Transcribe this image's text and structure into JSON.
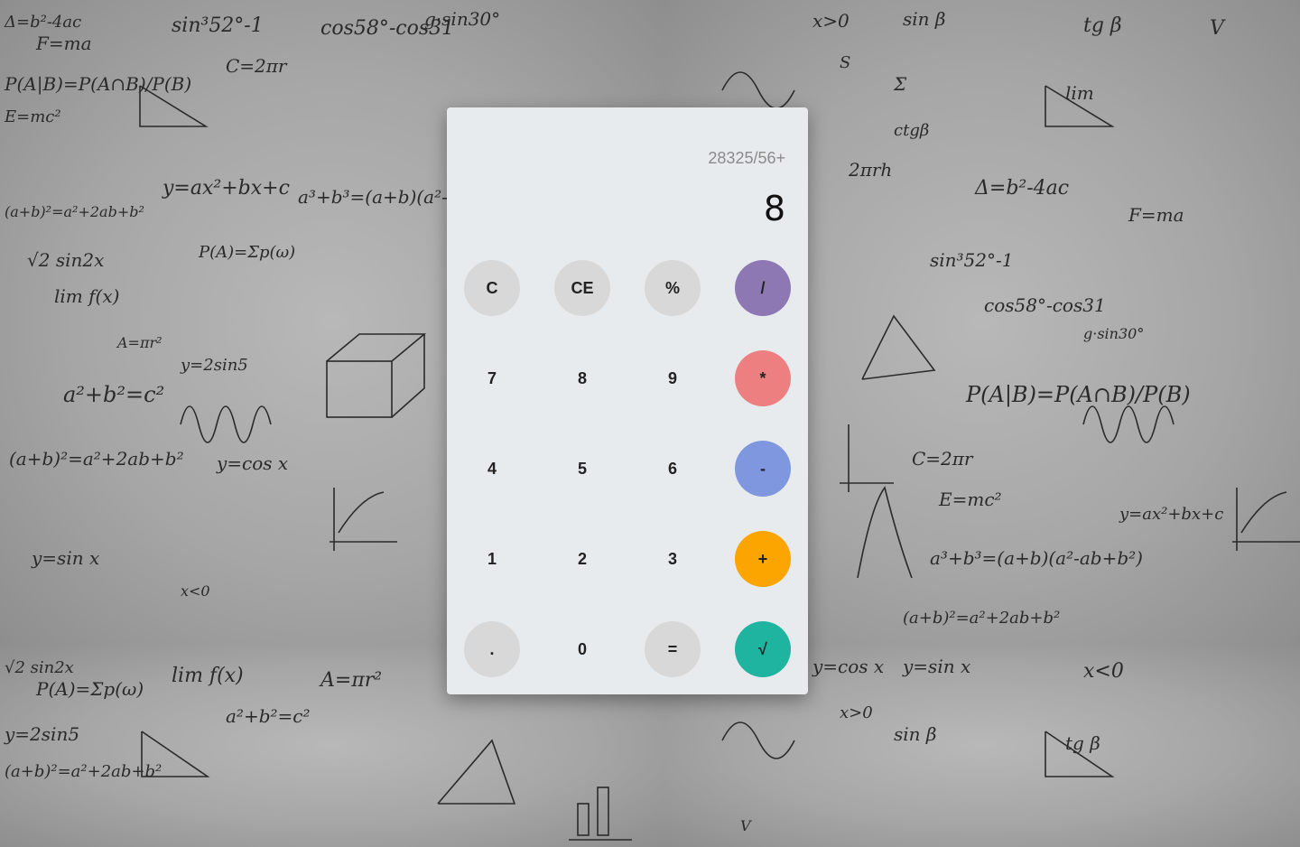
{
  "calculator": {
    "history": "28325/56+",
    "display": "8"
  },
  "keys": [
    {
      "label": "C",
      "name": "clear-button",
      "style": "gray"
    },
    {
      "label": "CE",
      "name": "clear-entry-button",
      "style": "gray"
    },
    {
      "label": "%",
      "name": "percent-button",
      "style": "gray"
    },
    {
      "label": "/",
      "name": "divide-button",
      "style": "op",
      "color": "#8e78b4"
    },
    {
      "label": "7",
      "name": "digit-7-button",
      "style": "plain"
    },
    {
      "label": "8",
      "name": "digit-8-button",
      "style": "plain"
    },
    {
      "label": "9",
      "name": "digit-9-button",
      "style": "plain"
    },
    {
      "label": "*",
      "name": "multiply-button",
      "style": "op",
      "color": "#ee7f80"
    },
    {
      "label": "4",
      "name": "digit-4-button",
      "style": "plain"
    },
    {
      "label": "5",
      "name": "digit-5-button",
      "style": "plain"
    },
    {
      "label": "6",
      "name": "digit-6-button",
      "style": "plain"
    },
    {
      "label": "-",
      "name": "subtract-button",
      "style": "op",
      "color": "#7f97df"
    },
    {
      "label": "1",
      "name": "digit-1-button",
      "style": "plain"
    },
    {
      "label": "2",
      "name": "digit-2-button",
      "style": "plain"
    },
    {
      "label": "3",
      "name": "digit-3-button",
      "style": "plain"
    },
    {
      "label": "+",
      "name": "add-button",
      "style": "op",
      "color": "#fca400"
    },
    {
      "label": ".",
      "name": "decimal-button",
      "style": "gray"
    },
    {
      "label": "0",
      "name": "digit-0-button",
      "style": "plain"
    },
    {
      "label": "=",
      "name": "equals-button",
      "style": "gray"
    },
    {
      "label": "√",
      "name": "square-root-button",
      "style": "op",
      "color": "#1eb4a0"
    }
  ],
  "background": {
    "formulas": [
      "Δ=b²-4ac",
      "F=ma",
      "sin³52°-1",
      "cos58°-cos31",
      "g·sin30°",
      "P(A|B)=P(A∩B)/P(B)",
      "C=2πr",
      "E=mc²",
      "y=ax²+bx+c",
      "a³+b³=(a+b)(a²-ab+b²)",
      "(a+b)²=a²+2ab+b²",
      "√2 sin2x",
      "P(A)=Σp(ω)",
      "lim f(x)",
      "A=πr²",
      "y=2sin5",
      "a²+b²=c²",
      "(a+b)²=a²+2ab+b²",
      "y=cos x",
      "y=sin x",
      "x<0",
      "x>0",
      "sin β",
      "tg β",
      "V",
      "S",
      "Σ",
      "lim",
      "ctgβ",
      "2πrh"
    ]
  }
}
